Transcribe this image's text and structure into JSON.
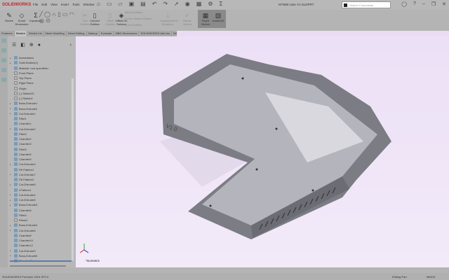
{
  "app": {
    "brand": "SOLIDWORKS",
    "title": "KFN68 case V1.SLDPRT",
    "menu": [
      "File",
      "Edit",
      "View",
      "Insert",
      "Tools",
      "Window"
    ],
    "search_placeholder": "Search Commands"
  },
  "ribbon": {
    "tools": [
      {
        "label": "Sketch",
        "icon": "sketch-icon",
        "enabled": true
      },
      {
        "label": "Smart Dimension",
        "icon": "dimension-icon",
        "enabled": true
      },
      {
        "label": "Equations",
        "icon": "sigma-icon",
        "enabled": true
      },
      {
        "label": "Trim Entities",
        "icon": "trim-icon",
        "enabled": false
      },
      {
        "label": "Convert Entities",
        "icon": "convert-icon",
        "enabled": true
      },
      {
        "label": "Offset Entities",
        "icon": "offset-icon",
        "enabled": false
      },
      {
        "label": "Offset On Surface",
        "icon": "offset-surface-icon",
        "enabled": true
      },
      {
        "label": "Mirror Entities",
        "icon": "mirror-icon",
        "enabled": false
      },
      {
        "label": "Linear Sketch Pattern",
        "icon": "pattern-icon",
        "enabled": false
      },
      {
        "label": "Move Entities",
        "icon": "move-icon",
        "enabled": false
      },
      {
        "label": "Display/Delete Relations",
        "icon": "relations-icon",
        "enabled": false
      },
      {
        "label": "Repair Sketch",
        "icon": "repair-icon",
        "enabled": false
      },
      {
        "label": "Quick Snaps",
        "icon": "snap-icon",
        "enabled": false
      },
      {
        "label": "Rapid Sketch",
        "icon": "rapid-sketch-icon",
        "enabled": true,
        "active": true
      },
      {
        "label": "Instant2D",
        "icon": "instant2d-icon",
        "enabled": true,
        "active": true
      }
    ]
  },
  "tabs": [
    {
      "label": "Features"
    },
    {
      "label": "Sketch",
      "selected": true
    },
    {
      "label": "Sketch Ink"
    },
    {
      "label": "Mesh Modeling"
    },
    {
      "label": "Direct Editing"
    },
    {
      "label": "Markup"
    },
    {
      "label": "Evaluate"
    },
    {
      "label": "MBD Dimensions"
    },
    {
      "label": "SOLIDWORKS Add-Ins"
    },
    {
      "label": "MBD"
    }
  ],
  "tree": [
    {
      "label": "Annotations",
      "exp": true
    },
    {
      "label": "Solid Bodies(1)",
      "exp": true
    },
    {
      "label": "Material <not specified>"
    },
    {
      "label": "Front Plane",
      "plane": true
    },
    {
      "label": "Top Plane",
      "plane": true
    },
    {
      "label": "Right Plane",
      "plane": true
    },
    {
      "label": "Origin",
      "plane": true
    },
    {
      "label": "(-) Sketch21",
      "plane": true
    },
    {
      "label": "(-) Sketch4",
      "plane": true
    },
    {
      "label": "Boss-Extrude1",
      "exp": true
    },
    {
      "label": "Boss-Extrude2",
      "exp": true
    },
    {
      "label": "Cut-Extrude1",
      "exp": true
    },
    {
      "label": "Fillet1"
    },
    {
      "label": "Chamfer1"
    },
    {
      "label": "Cut-Extrude2",
      "exp": true
    },
    {
      "label": "Fillet2"
    },
    {
      "label": "Chamfer2"
    },
    {
      "label": "Chamfer3"
    },
    {
      "label": "Fillet3"
    },
    {
      "label": "Chamfer5"
    },
    {
      "label": "Chamfer9"
    },
    {
      "label": "Cut-Extrude3",
      "exp": true
    },
    {
      "label": "Fill Pattern1"
    },
    {
      "label": "Cut-Extrude7",
      "exp": true
    },
    {
      "label": "Fill Pattern2"
    },
    {
      "label": "Cut-Extrude8",
      "exp": true
    },
    {
      "label": "LPattern1"
    },
    {
      "label": "Cut-Extrude4",
      "exp": true
    },
    {
      "label": "Cut-Extrude6",
      "exp": true
    },
    {
      "label": "Boss-Extrude3",
      "exp": true
    },
    {
      "label": "Chamfer6"
    },
    {
      "label": "Fillet4"
    },
    {
      "label": "Plane2",
      "plane": true
    },
    {
      "label": "Boss-Extrude4",
      "exp": true
    },
    {
      "label": "Cut-Extrude5",
      "exp": true
    },
    {
      "label": "Chamfer8"
    },
    {
      "label": "Chamfer10"
    },
    {
      "label": "Chamfer12"
    },
    {
      "label": "Cut-Extrude9",
      "exp": true
    },
    {
      "label": "Boss-Extrude5",
      "exp": true
    },
    {
      "label": "Chamfer11"
    }
  ],
  "viewport": {
    "view_label": "*Isometric",
    "model_text": "V1.0",
    "background": "#eee3f6",
    "model_color": "#8a8a92"
  },
  "status": {
    "product": "SOLIDWORKS Premium 2024 SP2.0",
    "mode": "Editing Part",
    "units": "MMGS"
  }
}
